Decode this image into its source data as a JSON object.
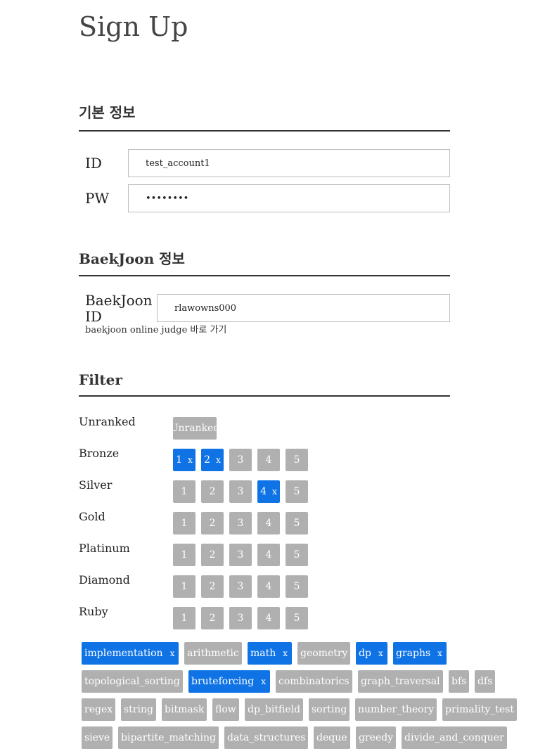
{
  "page": {
    "title": "Sign Up"
  },
  "basic": {
    "heading": "기본 정보",
    "id_label": "ID",
    "id_value": "test_account1",
    "pw_label": "PW",
    "pw_value": "••••••••"
  },
  "baekjoon": {
    "heading": "BaekJoon 정보",
    "id_label_line1": "BaekJoon",
    "id_label_line2": "ID",
    "id_value": "rlawowns000",
    "link_text": "baekjoon online judge 바로 가기"
  },
  "filter": {
    "heading": "Filter",
    "remove_mark": "x",
    "tiers": [
      {
        "label": "Unranked",
        "levels": [
          {
            "text": "Unranked",
            "selected": false
          }
        ]
      },
      {
        "label": "Bronze",
        "levels": [
          {
            "text": "1",
            "selected": true
          },
          {
            "text": "2",
            "selected": true
          },
          {
            "text": "3",
            "selected": false
          },
          {
            "text": "4",
            "selected": false
          },
          {
            "text": "5",
            "selected": false
          }
        ]
      },
      {
        "label": "Silver",
        "levels": [
          {
            "text": "1",
            "selected": false
          },
          {
            "text": "2",
            "selected": false
          },
          {
            "text": "3",
            "selected": false
          },
          {
            "text": "4",
            "selected": true
          },
          {
            "text": "5",
            "selected": false
          }
        ]
      },
      {
        "label": "Gold",
        "levels": [
          {
            "text": "1",
            "selected": false
          },
          {
            "text": "2",
            "selected": false
          },
          {
            "text": "3",
            "selected": false
          },
          {
            "text": "4",
            "selected": false
          },
          {
            "text": "5",
            "selected": false
          }
        ]
      },
      {
        "label": "Platinum",
        "levels": [
          {
            "text": "1",
            "selected": false
          },
          {
            "text": "2",
            "selected": false
          },
          {
            "text": "3",
            "selected": false
          },
          {
            "text": "4",
            "selected": false
          },
          {
            "text": "5",
            "selected": false
          }
        ]
      },
      {
        "label": "Diamond",
        "levels": [
          {
            "text": "1",
            "selected": false
          },
          {
            "text": "2",
            "selected": false
          },
          {
            "text": "3",
            "selected": false
          },
          {
            "text": "4",
            "selected": false
          },
          {
            "text": "5",
            "selected": false
          }
        ]
      },
      {
        "label": "Ruby",
        "levels": [
          {
            "text": "1",
            "selected": false
          },
          {
            "text": "2",
            "selected": false
          },
          {
            "text": "3",
            "selected": false
          },
          {
            "text": "4",
            "selected": false
          },
          {
            "text": "5",
            "selected": false
          }
        ]
      }
    ],
    "tags": [
      [
        {
          "text": "implementation",
          "selected": true
        },
        {
          "text": "arithmetic",
          "selected": false
        },
        {
          "text": "math",
          "selected": true
        },
        {
          "text": "geometry",
          "selected": false
        },
        {
          "text": "dp",
          "selected": true
        },
        {
          "text": "graphs",
          "selected": true
        }
      ],
      [
        {
          "text": "topological_sorting",
          "selected": false
        },
        {
          "text": "bruteforcing",
          "selected": true
        },
        {
          "text": "combinatorics",
          "selected": false
        },
        {
          "text": "graph_traversal",
          "selected": false
        },
        {
          "text": "bfs",
          "selected": false
        },
        {
          "text": "dfs",
          "selected": false
        }
      ],
      [
        {
          "text": "regex",
          "selected": false
        },
        {
          "text": "string",
          "selected": false
        },
        {
          "text": "bitmask",
          "selected": false
        },
        {
          "text": "flow",
          "selected": false
        },
        {
          "text": "dp_bitfield",
          "selected": false
        },
        {
          "text": "sorting",
          "selected": false
        },
        {
          "text": "number_theory",
          "selected": false
        },
        {
          "text": "primality_test",
          "selected": false
        }
      ],
      [
        {
          "text": "sieve",
          "selected": false
        },
        {
          "text": "bipartite_matching",
          "selected": false
        },
        {
          "text": "data_structures",
          "selected": false
        },
        {
          "text": "deque",
          "selected": false
        },
        {
          "text": "greedy",
          "selected": false
        },
        {
          "text": "divide_and_conquer",
          "selected": false
        }
      ]
    ]
  },
  "colors": {
    "selected": "#0f73e6",
    "unselected": "#b0b0b0",
    "rule": "#333333"
  }
}
